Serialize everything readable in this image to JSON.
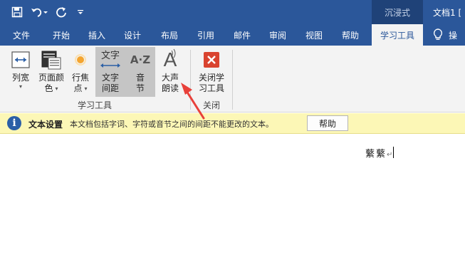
{
  "titlebar": {
    "immersive_label": "沉浸式",
    "doc_title": "文档1 [",
    "color": "#2b579a"
  },
  "tabs": [
    {
      "label": "文件"
    },
    {
      "label": "开始"
    },
    {
      "label": "插入"
    },
    {
      "label": "设计"
    },
    {
      "label": "布局"
    },
    {
      "label": "引用"
    },
    {
      "label": "邮件"
    },
    {
      "label": "审阅"
    },
    {
      "label": "视图"
    },
    {
      "label": "帮助"
    },
    {
      "label": "学习工具",
      "active": true
    }
  ],
  "tell_me": "操",
  "ribbon": {
    "column_width": {
      "line1": "列宽",
      "caret": "▾"
    },
    "page_color": {
      "line1": "页面颜",
      "line2": "色",
      "caret": "▾"
    },
    "line_focus": {
      "line1": "行焦",
      "line2": "点",
      "caret": "▾"
    },
    "text_spacing": {
      "icon_text": "文字",
      "line1": "文字",
      "line2": "间距"
    },
    "syllables": {
      "icon_text": "A·Z",
      "line1": "音",
      "line2": "节"
    },
    "read_aloud": {
      "icon_text": "A",
      "line1": "大声",
      "line2": "朗读"
    },
    "close_tools": {
      "line1": "关闭学",
      "line2": "习工具"
    },
    "group_learning": "学习工具",
    "group_close": "关闭"
  },
  "infobar": {
    "title": "文本设置",
    "message": "本文档包括字词、字符或音节之间的间距不能更改的文本。",
    "help_button": "帮助"
  },
  "document": {
    "text": "蘩蘩",
    "paragraph_mark": "↵"
  }
}
